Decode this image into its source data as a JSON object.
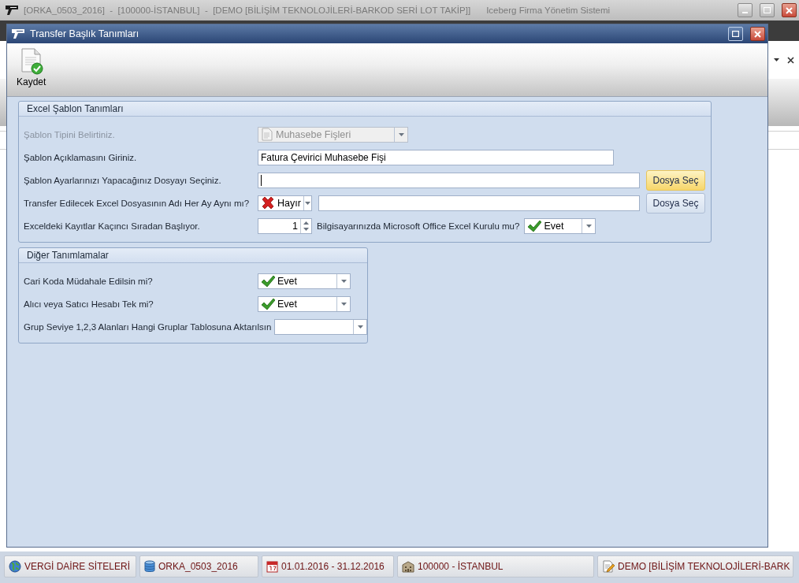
{
  "app_window": {
    "title": "[ORKA_0503_2016]  -  [100000-İSTANBUL]  -  [DEMO [BİLİŞİM TEKNOLOJİLERİ-BARKOD SERİ LOT TAKİP]]",
    "app_name": "Iceberg Firma Yönetim Sistemi"
  },
  "dialog": {
    "title": "Transfer Başlık Tanımları",
    "toolbar": [
      {
        "label": "Kaydet"
      }
    ]
  },
  "groups": [
    {
      "title": "Excel Şablon Tanımları",
      "rows": [
        {
          "kind": "combo",
          "label": "Şablon Tipini Belirtiniz.",
          "disabled": true,
          "value": "Muhasebe Fişleri"
        },
        {
          "kind": "text",
          "label": "Şablon Açıklamasını Giriniz.",
          "disabled": false,
          "value": "Fatura Çevirici Muhasebe Fişi"
        },
        {
          "kind": "file",
          "label": "Şablon Ayarlarınızı Yapacağınız Dosyayı Seçiniz.",
          "disabled": false,
          "focused": true,
          "button": {
            "label": "Dosya Seç",
            "hovered": true
          }
        },
        {
          "kind": "yesno-file",
          "label": "Transfer Edilecek Excel Dosyasının Adı Her Ay Aynı mı?",
          "disabled": false,
          "choice": {
            "value": "Hayır",
            "yes": false
          },
          "focused": false,
          "button": {
            "label": "Dosya Seç",
            "hovered": false
          }
        },
        {
          "kind": "spin",
          "label": "Exceldeki Kayıtlar Kaçıncı Sıradan Başlıyor.",
          "disabled": false,
          "value": "1",
          "extra_label": "Bilgisayarınızda Microsoft Office Excel Kurulu mu?",
          "choice": {
            "value": "Evet",
            "yes": true
          }
        }
      ]
    },
    {
      "title": "Diğer Tanımlamalar",
      "rows": [
        {
          "kind": "yesno",
          "label": "Cari Koda Müdahale Edilsin mi?",
          "disabled": false,
          "choice": {
            "value": "Evet",
            "yes": true
          }
        },
        {
          "kind": "yesno",
          "label": "Alıcı veya Satıcı Hesabı Tek mi?",
          "disabled": false,
          "choice": {
            "value": "Evet",
            "yes": true
          }
        },
        {
          "kind": "combo",
          "label": "Grup Seviye 1,2,3 Alanları Hangi Gruplar Tablosuna Aktarılsın",
          "disabled": false
        }
      ]
    }
  ],
  "status_bar": [
    {
      "text": "VERGİ DAİRE SİTELERİ"
    },
    {
      "text": "ORKA_0503_2016"
    },
    {
      "text": "01.01.2016 - 31.12.2016"
    },
    {
      "text": "100000 - İSTANBUL"
    },
    {
      "text": "DEMO [BİLİŞİM TEKNOLOJİLERİ-BARK"
    }
  ]
}
